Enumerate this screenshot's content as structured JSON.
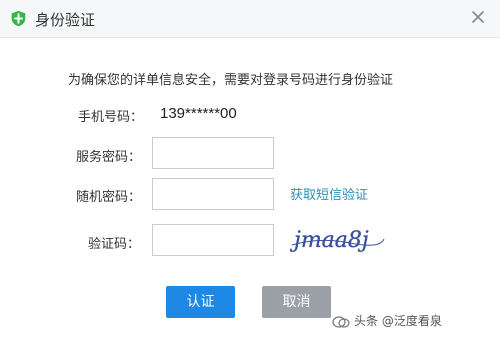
{
  "dialog": {
    "title": "身份验证",
    "notice": "为确保您的详单信息安全，需要对登录号码进行身份验证"
  },
  "form": {
    "phone_label": "手机号码：",
    "phone_value": "139******00",
    "service_pwd_label": "服务密码：",
    "random_pwd_label": "随机密码：",
    "get_sms_link": "获取短信验证",
    "captcha_label": "验证码：",
    "captcha_text": "jmaa8j"
  },
  "actions": {
    "confirm": "认证",
    "cancel": "取消"
  },
  "watermark": {
    "text": "头条 @泛度看泉"
  },
  "colors": {
    "primary_button": "#1e88e5",
    "cancel_button": "#9aa0a6",
    "link": "#2e8fb8",
    "shield_icon": "#3ab54a"
  }
}
